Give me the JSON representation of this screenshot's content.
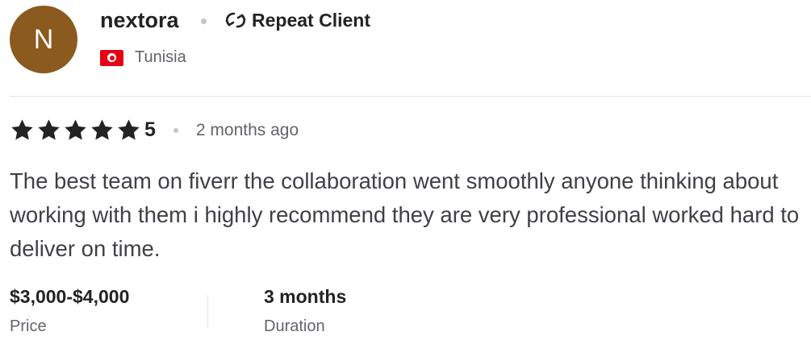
{
  "reviewer": {
    "avatar_initial": "N",
    "avatar_color": "#8b5a1f",
    "username": "nextora",
    "badge_label": "Repeat Client",
    "badge_icon": "repeat-icon",
    "country": "Tunisia",
    "flag_icon": "tunisia-flag-icon"
  },
  "review": {
    "rating": "5",
    "star_count": 5,
    "time_ago": "2 months ago",
    "text": "The best team on fiverr the collaboration went smoothly anyone thinking about working with them i highly recommend they are very professional worked hard to deliver on time."
  },
  "meta": {
    "price_value": "$3,000-$4,000",
    "price_label": "Price",
    "duration_value": "3 months",
    "duration_label": "Duration"
  },
  "colors": {
    "text_primary": "#222325",
    "text_secondary": "#62646a",
    "divider": "#e4e5e7"
  }
}
